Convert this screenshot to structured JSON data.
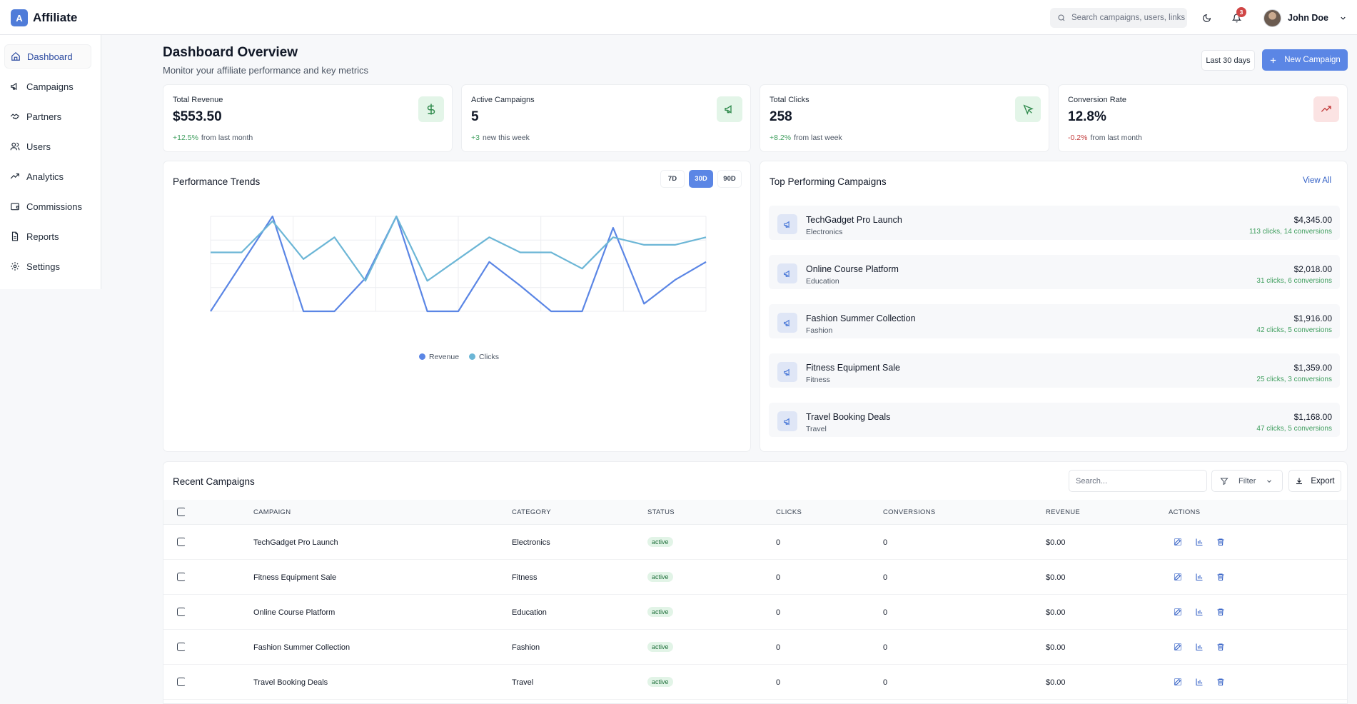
{
  "app": {
    "logo_letter": "A",
    "name": "Affiliate"
  },
  "header": {
    "search_placeholder": "Search campaigns, users, links...",
    "notification_count": "3",
    "user_name": "John Doe"
  },
  "sidebar": {
    "items": [
      {
        "label": "Dashboard",
        "icon": "home-icon"
      },
      {
        "label": "Campaigns",
        "icon": "megaphone-icon"
      },
      {
        "label": "Partners",
        "icon": "handshake-icon"
      },
      {
        "label": "Users",
        "icon": "users-icon"
      },
      {
        "label": "Analytics",
        "icon": "trending-up-icon"
      },
      {
        "label": "Commissions",
        "icon": "wallet-icon"
      },
      {
        "label": "Reports",
        "icon": "file-text-icon"
      },
      {
        "label": "Settings",
        "icon": "gear-icon"
      }
    ]
  },
  "page": {
    "title": "Dashboard Overview",
    "subtitle": "Monitor your affiliate performance and key metrics",
    "range_label": "Last 30 days",
    "new_campaign_label": "New Campaign"
  },
  "stats": [
    {
      "label": "Total Revenue",
      "value": "$553.50",
      "change": "+12.5%",
      "change_text": "from last month",
      "trend": "pos",
      "icon": "dollar-icon",
      "icon_bg": "#e3f5e8",
      "icon_color": "#2f8a4c"
    },
    {
      "label": "Active Campaigns",
      "value": "5",
      "change": "+3",
      "change_text": "new this week",
      "trend": "pos",
      "icon": "megaphone-icon",
      "icon_bg": "#e3f5e8",
      "icon_color": "#2f8a4c"
    },
    {
      "label": "Total Clicks",
      "value": "258",
      "change": "+8.2%",
      "change_text": "from last week",
      "trend": "pos",
      "icon": "cursor-icon",
      "icon_bg": "#e3f5e8",
      "icon_color": "#2f8a4c"
    },
    {
      "label": "Conversion Rate",
      "value": "12.8%",
      "change": "-0.2%",
      "change_text": "from last month",
      "trend": "neg",
      "icon": "trending-up-icon",
      "icon_bg": "#fbe3e3",
      "icon_color": "#c23a3a"
    }
  ],
  "performance": {
    "title": "Performance Trends",
    "ranges": [
      "7D",
      "30D",
      "90D"
    ],
    "active_range": "30D"
  },
  "chart_data": {
    "type": "line",
    "x": [
      1,
      2,
      3,
      4,
      5,
      6,
      7,
      8,
      9,
      10,
      11,
      12,
      13,
      14,
      15,
      16,
      17,
      18
    ],
    "series": [
      {
        "name": "Revenue",
        "color": "#5b86e5",
        "values": [
          0,
          50,
          100,
          0,
          0,
          35,
          100,
          0,
          0,
          52,
          27,
          0,
          0,
          88,
          8,
          33,
          52
        ]
      },
      {
        "name": "Clicks",
        "color": "#6cb6d6",
        "values": [
          62,
          62,
          95,
          55,
          78,
          32,
          100,
          32,
          55,
          78,
          62,
          62,
          45,
          78,
          70,
          70,
          78
        ]
      }
    ],
    "ylim": [
      0,
      100
    ],
    "grid": true,
    "legend": "bottom"
  },
  "top_campaigns": {
    "title": "Top Performing Campaigns",
    "view_all": "View All",
    "items": [
      {
        "name": "TechGadget Pro Launch",
        "category": "Electronics",
        "revenue": "$4,345.00",
        "stats": "113 clicks, 14 conversions"
      },
      {
        "name": "Online Course Platform",
        "category": "Education",
        "revenue": "$2,018.00",
        "stats": "31 clicks, 6 conversions"
      },
      {
        "name": "Fashion Summer Collection",
        "category": "Fashion",
        "revenue": "$1,916.00",
        "stats": "42 clicks, 5 conversions"
      },
      {
        "name": "Fitness Equipment Sale",
        "category": "Fitness",
        "revenue": "$1,359.00",
        "stats": "25 clicks, 3 conversions"
      },
      {
        "name": "Travel Booking Deals",
        "category": "Travel",
        "revenue": "$1,168.00",
        "stats": "47 clicks, 5 conversions"
      }
    ]
  },
  "recent": {
    "title": "Recent Campaigns",
    "search_placeholder": "Search...",
    "filter_label": "Filter",
    "export_label": "Export",
    "columns": [
      "CAMPAIGN",
      "CATEGORY",
      "STATUS",
      "CLICKS",
      "CONVERSIONS",
      "REVENUE",
      "ACTIONS"
    ],
    "rows": [
      {
        "campaign": "TechGadget Pro Launch",
        "category": "Electronics",
        "status": "active",
        "clicks": "0",
        "conversions": "0",
        "revenue": "$0.00"
      },
      {
        "campaign": "Fitness Equipment Sale",
        "category": "Fitness",
        "status": "active",
        "clicks": "0",
        "conversions": "0",
        "revenue": "$0.00"
      },
      {
        "campaign": "Online Course Platform",
        "category": "Education",
        "status": "active",
        "clicks": "0",
        "conversions": "0",
        "revenue": "$0.00"
      },
      {
        "campaign": "Fashion Summer Collection",
        "category": "Fashion",
        "status": "active",
        "clicks": "0",
        "conversions": "0",
        "revenue": "$0.00"
      },
      {
        "campaign": "Travel Booking Deals",
        "category": "Travel",
        "status": "active",
        "clicks": "0",
        "conversions": "0",
        "revenue": "$0.00"
      }
    ]
  },
  "colors": {
    "accent": "#5b86e5",
    "positive": "#3f9e5e",
    "negative": "#c23a3a"
  }
}
